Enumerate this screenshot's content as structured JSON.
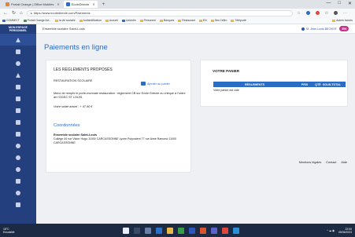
{
  "browser": {
    "tabs": [
      {
        "label": "Portail Orange | Office Mobiles",
        "active": false,
        "color": "#e8832e"
      },
      {
        "label": "EcoleDirecte",
        "active": true,
        "color": "#2b6cc4"
      }
    ],
    "new_tab": "+",
    "window_controls": [
      "—",
      "□",
      "✕"
    ],
    "url": "https://www.ecoledirecte.com/Paiements",
    "bookmarks": [
      {
        "label": "CONNECT",
        "icon": "blue"
      },
      {
        "label": "Portail Orange Act...",
        "icon": "green"
      },
      {
        "label": "la vie scolaire",
        "icon": "folder"
      },
      {
        "label": "Authentification",
        "icon": "folder"
      },
      {
        "label": "Accueil",
        "icon": "folder"
      },
      {
        "label": "LinkedIn",
        "icon": "blue"
      },
      {
        "label": "Personnel",
        "icon": "folder"
      },
      {
        "label": "Banques",
        "icon": "folder"
      },
      {
        "label": "Restaurant",
        "icon": "folder"
      },
      {
        "label": "EN",
        "icon": "folder"
      },
      {
        "label": "Ses Celfro",
        "icon": "folder"
      },
      {
        "label": "Téléporté",
        "icon": "folder"
      }
    ],
    "bookmarks_more": "Autres favoris"
  },
  "leftnav": {
    "brand_line1": "MON ESPACE",
    "brand_line2": "PERSONNEL",
    "items": [
      {
        "icon": "home-icon",
        "active": true
      },
      {
        "icon": "message-icon"
      },
      {
        "icon": "users-icon"
      },
      {
        "icon": "graduation-icon"
      },
      {
        "icon": "calendar-icon"
      },
      {
        "icon": "document-icon"
      },
      {
        "icon": "notes-icon"
      },
      {
        "icon": "presentation-icon"
      },
      {
        "icon": "file-icon"
      },
      {
        "icon": "share-icon"
      },
      {
        "icon": "cloud-icon"
      },
      {
        "icon": "euro-icon"
      },
      {
        "icon": "list-icon"
      },
      {
        "icon": "settings-icon"
      },
      {
        "icon": "calendar-small-icon"
      }
    ]
  },
  "header": {
    "school": "Ensemble scolaire Saint-Louis",
    "user": "M. Jean-Louis BECKER",
    "badge": "EN"
  },
  "page": {
    "title": "Paiements en ligne"
  },
  "proposals": {
    "heading": "LES RÈGLEMENTS PROPOSÉS",
    "item_title": "RESTAURATION SCOLAIRE",
    "add_label": "Ajouter au panier",
    "description": "Merci de remplir le porte-monnaie restauration : règlement CB sur Ecole Directe ou chèque à l'ordre de l'OGEC ST LOUIS.",
    "balance": "Votre solde actuel : + 47,90 €",
    "contact_title": "Coordonnées",
    "org_name": "Ensemble scolaire Saint-Louis",
    "address": "Collège 44 rue Victor Hugo 11000 CARCASSONNE Lycée Polyvalent 77 rue Aimé Ramond 11000 CARCASSONNE"
  },
  "cart": {
    "heading": "VOTRE PANIER",
    "columns": [
      "RÈGLEMENTS",
      "PRIX",
      "QTÉ",
      "SOUS-TOTAL"
    ],
    "empty": "Votre panier est vide"
  },
  "footer": {
    "links": [
      "Mentions légales",
      "Contact",
      "Aide"
    ]
  },
  "taskbar": {
    "weather_temp": "18°C",
    "weather_desc": "Ensoleillé",
    "time": "22:00",
    "date": "05/06/2023"
  },
  "colors": {
    "nav_bg": "#233f7d",
    "accent": "#2b6cc4",
    "badge": "#c6368c"
  }
}
